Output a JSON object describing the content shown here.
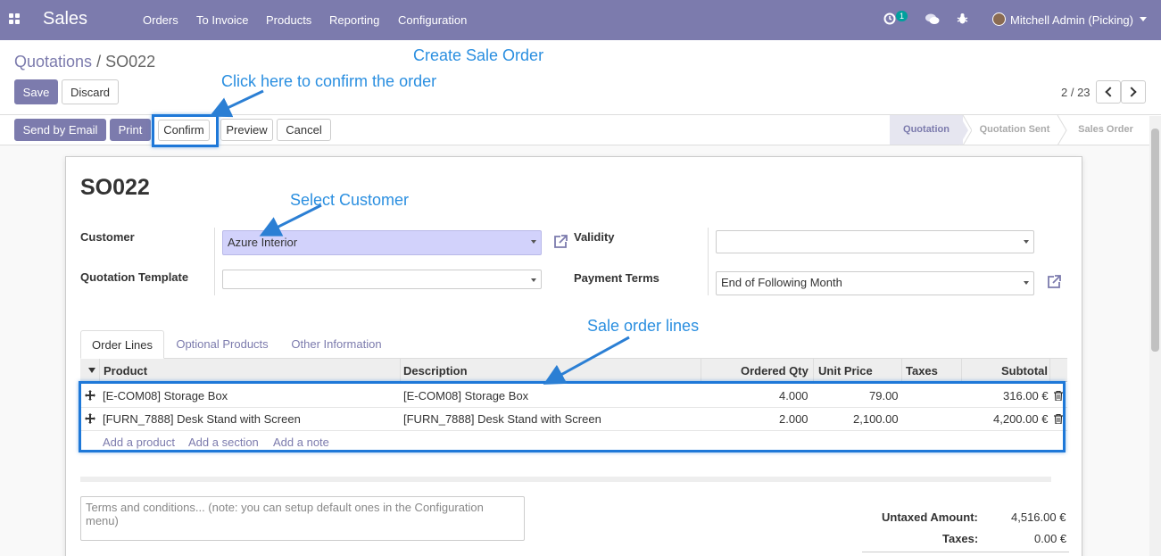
{
  "navbar": {
    "brand": "Sales",
    "menu": [
      "Orders",
      "To Invoice",
      "Products",
      "Reporting",
      "Configuration"
    ],
    "activity_badge": "1",
    "user": "Mitchell Admin (Picking)"
  },
  "breadcrumb": {
    "parent": "Quotations",
    "separator": "/",
    "current": "SO022"
  },
  "control": {
    "save": "Save",
    "discard": "Discard",
    "pager": "2 / 23"
  },
  "actions": {
    "send_email": "Send by Email",
    "print": "Print",
    "confirm": "Confirm",
    "preview": "Preview",
    "cancel": "Cancel"
  },
  "stages": {
    "quotation": "Quotation",
    "quotation_sent": "Quotation Sent",
    "sales_order": "Sales Order"
  },
  "form": {
    "title": "SO022",
    "customer_label": "Customer",
    "customer_value": "Azure Interior",
    "template_label": "Quotation Template",
    "template_value": "",
    "validity_label": "Validity",
    "validity_value": "",
    "payment_terms_label": "Payment Terms",
    "payment_terms_value": "End of Following Month"
  },
  "tabs": {
    "order_lines": "Order Lines",
    "optional_products": "Optional Products",
    "other_info": "Other Information"
  },
  "table": {
    "headers": {
      "product": "Product",
      "description": "Description",
      "qty": "Ordered Qty",
      "unit_price": "Unit Price",
      "taxes": "Taxes",
      "subtotal": "Subtotal"
    },
    "rows": [
      {
        "product": "[E-COM08] Storage Box",
        "description": "[E-COM08] Storage Box",
        "qty": "4.000",
        "unit_price": "79.00",
        "taxes": "",
        "subtotal": "316.00 €"
      },
      {
        "product": "[FURN_7888] Desk Stand with Screen",
        "description": "[FURN_7888] Desk Stand with Screen",
        "qty": "2.000",
        "unit_price": "2,100.00",
        "taxes": "",
        "subtotal": "4,200.00 €"
      }
    ],
    "add_product": "Add a product",
    "add_section": "Add a section",
    "add_note": "Add a note"
  },
  "terms_placeholder": "Terms and conditions... (note: you can setup default ones in the Configuration menu)",
  "totals": {
    "untaxed_label": "Untaxed Amount:",
    "untaxed_value": "4,516.00 €",
    "taxes_label": "Taxes:",
    "taxes_value": "0.00 €"
  },
  "annotations": {
    "create_order": "Create Sale Order",
    "confirm_hint": "Click here to confirm the order",
    "select_customer": "Select Customer",
    "order_lines": "Sale order lines"
  },
  "colors": {
    "brand": "#7c7bad",
    "annotation": "#2b8fe0",
    "highlight": "#1e78d8"
  }
}
